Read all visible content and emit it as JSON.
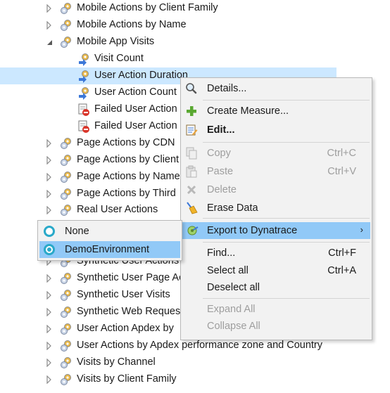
{
  "tree": {
    "items": [
      {
        "label": "Mobile Actions by Client Family",
        "indent": 0,
        "expander": "collapsed",
        "icon": "gear-group-icon"
      },
      {
        "label": "Mobile Actions by Name",
        "indent": 0,
        "expander": "collapsed",
        "icon": "gear-group-icon"
      },
      {
        "label": "Mobile App Visits",
        "indent": 0,
        "expander": "expanded",
        "icon": "gear-group-icon"
      },
      {
        "label": "Visit Count",
        "indent": 1,
        "expander": "none",
        "icon": "measure-icon"
      },
      {
        "label": "User Action Duration",
        "indent": 1,
        "expander": "none",
        "icon": "measure-icon",
        "selected": true
      },
      {
        "label": "User Action Count",
        "indent": 1,
        "expander": "none",
        "icon": "measure-icon"
      },
      {
        "label": "Failed User Action",
        "indent": 1,
        "expander": "none",
        "icon": "failed-measure-icon"
      },
      {
        "label": "Failed User Action",
        "indent": 1,
        "expander": "none",
        "icon": "failed-measure-icon"
      },
      {
        "label": "Page Actions by CDN",
        "indent": 0,
        "expander": "collapsed",
        "icon": "gear-group-icon"
      },
      {
        "label": "Page Actions by Client",
        "indent": 0,
        "expander": "collapsed",
        "icon": "gear-group-icon"
      },
      {
        "label": "Page Actions by Name",
        "indent": 0,
        "expander": "collapsed",
        "icon": "gear-group-icon"
      },
      {
        "label": "Page Actions by Third",
        "indent": 0,
        "expander": "collapsed",
        "icon": "gear-group-icon"
      },
      {
        "label": "Real User Actions",
        "indent": 0,
        "expander": "collapsed",
        "icon": "gear-group-icon"
      },
      {
        "label": "",
        "indent": 0,
        "expander": "collapsed",
        "icon": "gear-group-icon"
      },
      {
        "label": "Synthetic User Actions",
        "indent": 0,
        "expander": "collapsed",
        "icon": "gear-group-icon"
      },
      {
        "label": "Synthetic User Page Ac",
        "indent": 0,
        "expander": "collapsed",
        "icon": "gear-group-icon"
      },
      {
        "label": "Synthetic User Visits",
        "indent": 0,
        "expander": "collapsed",
        "icon": "gear-group-icon"
      },
      {
        "label": "Synthetic Web Reques",
        "indent": 0,
        "expander": "collapsed",
        "icon": "gear-group-icon"
      },
      {
        "label": "User Action Apdex by",
        "indent": 0,
        "expander": "collapsed",
        "icon": "gear-group-icon"
      },
      {
        "label": "User Actions by Apdex performance zone and Country",
        "indent": 0,
        "expander": "collapsed",
        "icon": "gear-group-icon"
      },
      {
        "label": "Visits by Channel",
        "indent": 0,
        "expander": "collapsed",
        "icon": "gear-group-icon"
      },
      {
        "label": "Visits by Client Family",
        "indent": 0,
        "expander": "collapsed",
        "icon": "gear-group-icon"
      }
    ]
  },
  "context_menu": {
    "details": {
      "label": "Details...",
      "icon": "magnifier-icon"
    },
    "create_measure": {
      "label": "Create Measure...",
      "icon": "plus-icon"
    },
    "edit": {
      "label": "Edit...",
      "icon": "edit-icon"
    },
    "copy": {
      "label": "Copy",
      "shortcut": "Ctrl+C",
      "icon": "copy-icon"
    },
    "paste": {
      "label": "Paste",
      "shortcut": "Ctrl+V",
      "icon": "paste-icon"
    },
    "delete": {
      "label": "Delete",
      "icon": "delete-icon"
    },
    "erase_data": {
      "label": "Erase Data",
      "icon": "broom-icon"
    },
    "export": {
      "label": "Export to Dynatrace",
      "arrow": "›",
      "icon": "export-icon"
    },
    "find": {
      "label": "Find...",
      "shortcut": "Ctrl+F"
    },
    "select_all": {
      "label": "Select all",
      "shortcut": "Ctrl+A"
    },
    "deselect_all": {
      "label": "Deselect all"
    },
    "expand_all": {
      "label": "Expand All"
    },
    "collapse_all": {
      "label": "Collapse All"
    }
  },
  "submenu": {
    "items": [
      {
        "label": "None",
        "checked": false
      },
      {
        "label": "DemoEnvironment",
        "checked": true
      }
    ]
  },
  "colors": {
    "selection": "#cce8ff",
    "menu_hover": "#91c9f7",
    "menu_bg": "#f2f2f2",
    "disabled_text": "#9e9e9e",
    "radio_accent": "#29a9c9"
  }
}
